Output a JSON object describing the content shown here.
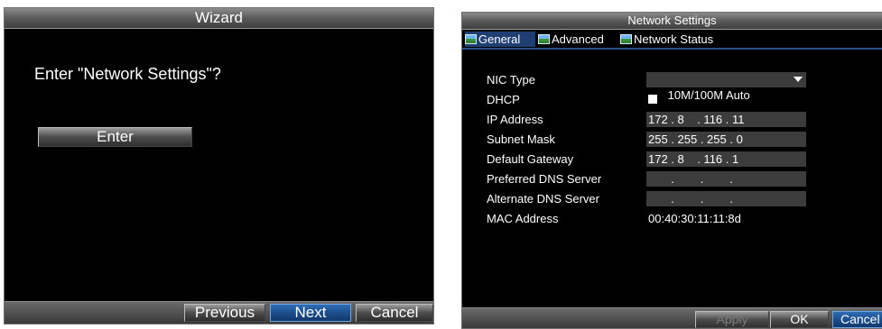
{
  "wizard": {
    "title": "Wizard",
    "prompt": "Enter \"Network Settings\"?",
    "enter_label": "Enter",
    "footer": {
      "previous_label": "Previous",
      "next_label": "Next",
      "cancel_label": "Cancel"
    }
  },
  "network_settings": {
    "title": "Network Settings",
    "tabs": [
      {
        "label": "General",
        "icon": "network-settings-icon",
        "active": true
      },
      {
        "label": "Advanced",
        "icon": "network-settings-icon",
        "active": false
      },
      {
        "label": "Network Status",
        "icon": "network-settings-icon",
        "active": false
      }
    ],
    "fields": {
      "nic_type": {
        "label": "NIC Type",
        "value": "10M/100M Auto"
      },
      "dhcp": {
        "label": "DHCP",
        "checked": false
      },
      "ip_address": {
        "label": "IP Address",
        "value": "172 . 8    . 116 . 11"
      },
      "subnet_mask": {
        "label": "Subnet Mask",
        "value": "255 . 255 . 255 . 0"
      },
      "default_gateway": {
        "label": "Default Gateway",
        "value": "172 . 8    . 116 . 1"
      },
      "preferred_dns": {
        "label": "Preferred DNS Server",
        "value": "       .        .        ."
      },
      "alternate_dns": {
        "label": "Alternate DNS Server",
        "value": "       .        .        ."
      },
      "mac_address": {
        "label": "MAC Address",
        "value": "00:40:30:11:11:8d"
      }
    },
    "footer": {
      "apply_label": "Apply",
      "ok_label": "OK",
      "cancel_label": "Cancel"
    }
  },
  "colors": {
    "panel_bg": "#000000",
    "highlight_blue": "#1d4f8e",
    "field_bg": "#3c3c3c"
  }
}
